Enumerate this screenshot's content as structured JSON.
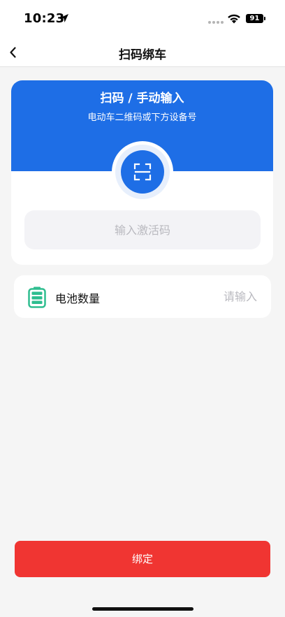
{
  "status_bar": {
    "time": "10:23",
    "battery_level": "91",
    "icons": [
      "location-arrow-icon",
      "signal-dots-icon",
      "wifi-icon",
      "battery-icon"
    ]
  },
  "nav": {
    "title": "扫码绑车",
    "back_icon": "chevron-left-icon"
  },
  "scan_card": {
    "title": "扫码 / 手动输入",
    "subtitle": "电动车二维码或下方设备号",
    "scan_icon": "scan-frame-icon",
    "input_placeholder": "输入激活码",
    "input_value": ""
  },
  "battery_row": {
    "label": "电池数量",
    "icon": "battery-green-icon",
    "input_placeholder": "请输入",
    "input_value": ""
  },
  "footer": {
    "bind_label": "绑定"
  },
  "colors": {
    "primary_blue": "#1e6ee6",
    "danger_red": "#f03532",
    "battery_green": "#2ebd8f",
    "background": "#f5f5f5"
  }
}
